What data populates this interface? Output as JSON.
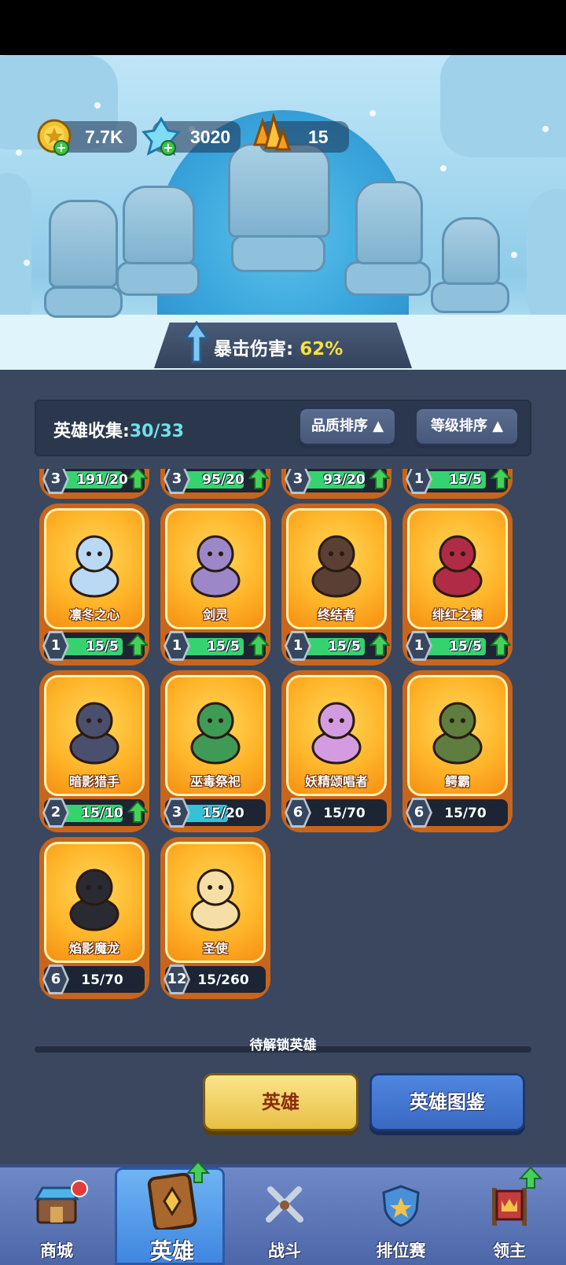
{
  "currencies": [
    {
      "name": "gold",
      "value": "7.7K",
      "icon": "gold-coin-icon"
    },
    {
      "name": "crystal",
      "value": "3020",
      "icon": "blue-crystal-icon"
    },
    {
      "name": "amber",
      "value": "15",
      "icon": "amber-crystal-icon"
    }
  ],
  "banner": {
    "label": "暴击伤害:",
    "value": "62%"
  },
  "collection": {
    "label": "英雄收集:",
    "count": "30/33"
  },
  "sort": {
    "quality": "品质排序 ▲",
    "level": "等级排序 ▲"
  },
  "partial_row": [
    {
      "level": "3",
      "progress": "191/20",
      "fill": 1.0
    },
    {
      "level": "3",
      "progress": "95/20",
      "fill": 1.0
    },
    {
      "level": "3",
      "progress": "93/20",
      "fill": 1.0
    },
    {
      "level": "1",
      "progress": "15/5",
      "fill": 1.0
    }
  ],
  "heroes": [
    {
      "name": "凛冬之心",
      "level": "1",
      "progress": "15/5",
      "fill": 1.0,
      "upgrade": true,
      "color": "#b9d9f5"
    },
    {
      "name": "剑灵",
      "level": "1",
      "progress": "15/5",
      "fill": 1.0,
      "upgrade": true,
      "color": "#9c88c8"
    },
    {
      "name": "终结者",
      "level": "1",
      "progress": "15/5",
      "fill": 1.0,
      "upgrade": true,
      "color": "#5a3f35"
    },
    {
      "name": "绯红之镰",
      "level": "1",
      "progress": "15/5",
      "fill": 1.0,
      "upgrade": true,
      "color": "#b02b45"
    },
    {
      "name": "暗影猎手",
      "level": "2",
      "progress": "15/10",
      "fill": 1.0,
      "upgrade": true,
      "color": "#4b4f6e"
    },
    {
      "name": "巫毒祭祀",
      "level": "3",
      "progress": "15/20",
      "fill": 0.75,
      "upgrade": false,
      "color": "#3f9a56"
    },
    {
      "name": "妖精颂唱者",
      "level": "6",
      "progress": "15/70",
      "fill": 0.04,
      "upgrade": false,
      "color": "#d49ce0"
    },
    {
      "name": "鳄霸",
      "level": "6",
      "progress": "15/70",
      "fill": 0.04,
      "upgrade": false,
      "color": "#5e7d3f"
    },
    {
      "name": "焰影魔龙",
      "level": "6",
      "progress": "15/70",
      "fill": 0.04,
      "upgrade": false,
      "color": "#2a2a33"
    },
    {
      "name": "圣使",
      "level": "12",
      "progress": "15/260",
      "fill": 0.0,
      "upgrade": false,
      "color": "#f5dfa6"
    }
  ],
  "locked": {
    "label": "待解锁英雄"
  },
  "actions": {
    "hero": "英雄",
    "book": "英雄图鉴"
  },
  "nav": [
    {
      "label": "商城",
      "icon": "shop-icon"
    },
    {
      "label": "英雄",
      "icon": "hero-card-icon"
    },
    {
      "label": "战斗",
      "icon": "crossed-swords-icon"
    },
    {
      "label": "排位赛",
      "icon": "ranked-shield-icon"
    },
    {
      "label": "领主",
      "icon": "lord-banner-icon"
    }
  ]
}
